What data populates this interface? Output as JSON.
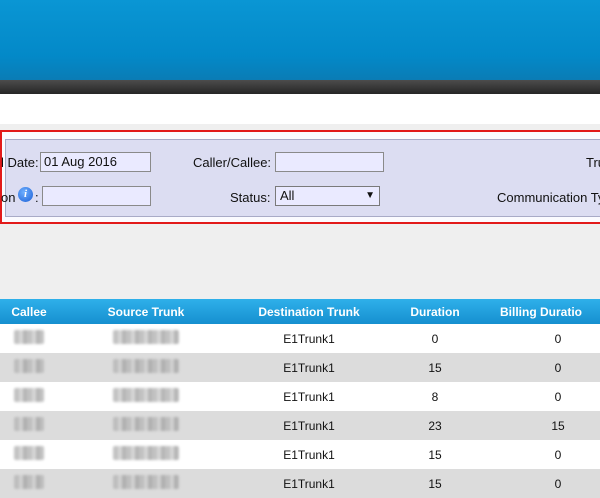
{
  "filters": {
    "date_label": "l Date:",
    "date_value": "01 Aug 2016",
    "caller_label": "Caller/Callee:",
    "caller_value": "",
    "trunk_label": "Tru",
    "duration_label": "on",
    "duration_colon": ":",
    "duration_value": "",
    "status_label": "Status:",
    "status_value": "All",
    "comm_type_label": "Communication Ty",
    "info_icon_glyph": "i"
  },
  "table": {
    "headers": [
      "Callee",
      "Source Trunk",
      "Destination Trunk",
      "Duration",
      "Billing Duratio"
    ],
    "rows": [
      {
        "destination": "E1Trunk1",
        "duration": "0",
        "billing": "0"
      },
      {
        "destination": "E1Trunk1",
        "duration": "15",
        "billing": "0"
      },
      {
        "destination": "E1Trunk1",
        "duration": "8",
        "billing": "0"
      },
      {
        "destination": "E1Trunk1",
        "duration": "23",
        "billing": "15"
      },
      {
        "destination": "E1Trunk1",
        "duration": "15",
        "billing": "0"
      },
      {
        "destination": "E1Trunk1",
        "duration": "15",
        "billing": "0"
      }
    ]
  },
  "colors": {
    "header_blue": "#0389c8",
    "highlight_border": "#e21a1a",
    "table_header": "#1a9ad8"
  }
}
